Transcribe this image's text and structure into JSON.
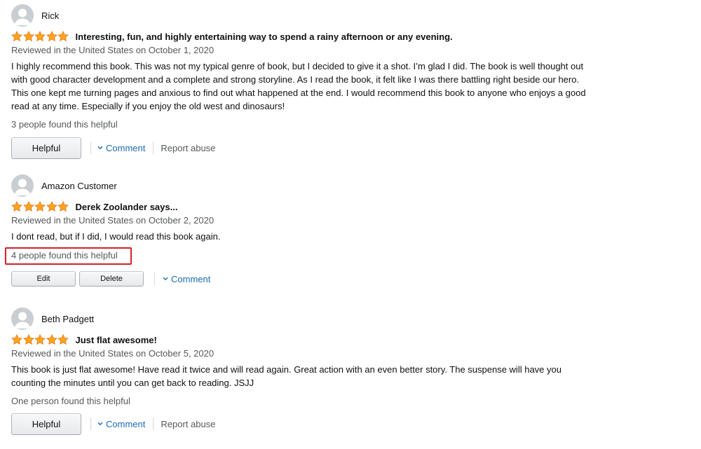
{
  "icons": {
    "avatar": "avatar-icon",
    "star": "star-icon",
    "chevron": "chevron-down-icon"
  },
  "colors": {
    "star_fill": "#ffa41c",
    "star_stroke": "#de7921",
    "link": "#1a6bb3",
    "muted_text": "#565959",
    "highlight_border": "#d81f26"
  },
  "reviews": [
    {
      "name": "Rick",
      "rating": 5,
      "title": "Interesting, fun, and highly entertaining way to spend a rainy afternoon or any evening.",
      "date": "Reviewed in the United States on October 1, 2020",
      "body": "I highly recommend this book. This was not my typical genre of book, but I decided to give it a shot. I’m glad I did. The book is well thought out with good character development and a complete and strong storyline. As I read the book, it felt like I was there battling right beside our hero. This one kept me turning pages and anxious to find out what happened at the end. I would recommend this book to anyone who enjoys a good read at any time. Especially if you enjoy the old west and dinosaurs!",
      "helpful": "3 people found this helpful",
      "helpful_button": "Helpful",
      "comment": "Comment",
      "report": "Report abuse"
    },
    {
      "name": "Amazon Customer",
      "rating": 5,
      "title": "Derek Zoolander says...",
      "date": "Reviewed in the United States on October 2, 2020",
      "body": "I dont read, but if I did, I would read this book again.",
      "helpful": "4 people found this helpful",
      "edit_button": "Edit",
      "delete_button": "Delete",
      "comment": "Comment"
    },
    {
      "name": "Beth Padgett",
      "rating": 5,
      "title": "Just flat awesome!",
      "date": "Reviewed in the United States on October 5, 2020",
      "body": "This book is just flat awesome! Have read it twice and will read again. Great action with an even better story. The suspense will have you counting the minutes until you can get back to reading. JSJJ",
      "helpful": "One person found this helpful",
      "helpful_button": "Helpful",
      "comment": "Comment",
      "report": "Report abuse"
    }
  ]
}
